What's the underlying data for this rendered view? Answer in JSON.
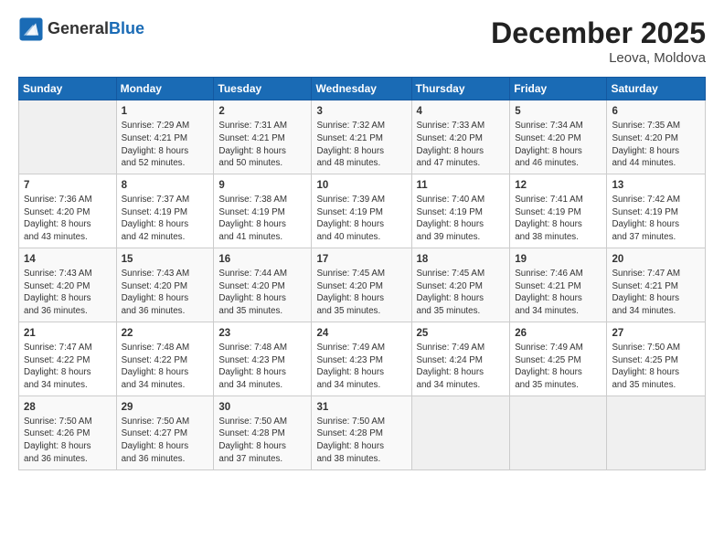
{
  "header": {
    "logo_line1": "General",
    "logo_line2": "Blue",
    "month": "December 2025",
    "location": "Leova, Moldova"
  },
  "weekdays": [
    "Sunday",
    "Monday",
    "Tuesday",
    "Wednesday",
    "Thursday",
    "Friday",
    "Saturday"
  ],
  "weeks": [
    [
      {
        "day": "",
        "info": ""
      },
      {
        "day": "1",
        "info": "Sunrise: 7:29 AM\nSunset: 4:21 PM\nDaylight: 8 hours\nand 52 minutes."
      },
      {
        "day": "2",
        "info": "Sunrise: 7:31 AM\nSunset: 4:21 PM\nDaylight: 8 hours\nand 50 minutes."
      },
      {
        "day": "3",
        "info": "Sunrise: 7:32 AM\nSunset: 4:21 PM\nDaylight: 8 hours\nand 48 minutes."
      },
      {
        "day": "4",
        "info": "Sunrise: 7:33 AM\nSunset: 4:20 PM\nDaylight: 8 hours\nand 47 minutes."
      },
      {
        "day": "5",
        "info": "Sunrise: 7:34 AM\nSunset: 4:20 PM\nDaylight: 8 hours\nand 46 minutes."
      },
      {
        "day": "6",
        "info": "Sunrise: 7:35 AM\nSunset: 4:20 PM\nDaylight: 8 hours\nand 44 minutes."
      }
    ],
    [
      {
        "day": "7",
        "info": "Sunrise: 7:36 AM\nSunset: 4:20 PM\nDaylight: 8 hours\nand 43 minutes."
      },
      {
        "day": "8",
        "info": "Sunrise: 7:37 AM\nSunset: 4:19 PM\nDaylight: 8 hours\nand 42 minutes."
      },
      {
        "day": "9",
        "info": "Sunrise: 7:38 AM\nSunset: 4:19 PM\nDaylight: 8 hours\nand 41 minutes."
      },
      {
        "day": "10",
        "info": "Sunrise: 7:39 AM\nSunset: 4:19 PM\nDaylight: 8 hours\nand 40 minutes."
      },
      {
        "day": "11",
        "info": "Sunrise: 7:40 AM\nSunset: 4:19 PM\nDaylight: 8 hours\nand 39 minutes."
      },
      {
        "day": "12",
        "info": "Sunrise: 7:41 AM\nSunset: 4:19 PM\nDaylight: 8 hours\nand 38 minutes."
      },
      {
        "day": "13",
        "info": "Sunrise: 7:42 AM\nSunset: 4:19 PM\nDaylight: 8 hours\nand 37 minutes."
      }
    ],
    [
      {
        "day": "14",
        "info": "Sunrise: 7:43 AM\nSunset: 4:20 PM\nDaylight: 8 hours\nand 36 minutes."
      },
      {
        "day": "15",
        "info": "Sunrise: 7:43 AM\nSunset: 4:20 PM\nDaylight: 8 hours\nand 36 minutes."
      },
      {
        "day": "16",
        "info": "Sunrise: 7:44 AM\nSunset: 4:20 PM\nDaylight: 8 hours\nand 35 minutes."
      },
      {
        "day": "17",
        "info": "Sunrise: 7:45 AM\nSunset: 4:20 PM\nDaylight: 8 hours\nand 35 minutes."
      },
      {
        "day": "18",
        "info": "Sunrise: 7:45 AM\nSunset: 4:20 PM\nDaylight: 8 hours\nand 35 minutes."
      },
      {
        "day": "19",
        "info": "Sunrise: 7:46 AM\nSunset: 4:21 PM\nDaylight: 8 hours\nand 34 minutes."
      },
      {
        "day": "20",
        "info": "Sunrise: 7:47 AM\nSunset: 4:21 PM\nDaylight: 8 hours\nand 34 minutes."
      }
    ],
    [
      {
        "day": "21",
        "info": "Sunrise: 7:47 AM\nSunset: 4:22 PM\nDaylight: 8 hours\nand 34 minutes."
      },
      {
        "day": "22",
        "info": "Sunrise: 7:48 AM\nSunset: 4:22 PM\nDaylight: 8 hours\nand 34 minutes."
      },
      {
        "day": "23",
        "info": "Sunrise: 7:48 AM\nSunset: 4:23 PM\nDaylight: 8 hours\nand 34 minutes."
      },
      {
        "day": "24",
        "info": "Sunrise: 7:49 AM\nSunset: 4:23 PM\nDaylight: 8 hours\nand 34 minutes."
      },
      {
        "day": "25",
        "info": "Sunrise: 7:49 AM\nSunset: 4:24 PM\nDaylight: 8 hours\nand 34 minutes."
      },
      {
        "day": "26",
        "info": "Sunrise: 7:49 AM\nSunset: 4:25 PM\nDaylight: 8 hours\nand 35 minutes."
      },
      {
        "day": "27",
        "info": "Sunrise: 7:50 AM\nSunset: 4:25 PM\nDaylight: 8 hours\nand 35 minutes."
      }
    ],
    [
      {
        "day": "28",
        "info": "Sunrise: 7:50 AM\nSunset: 4:26 PM\nDaylight: 8 hours\nand 36 minutes."
      },
      {
        "day": "29",
        "info": "Sunrise: 7:50 AM\nSunset: 4:27 PM\nDaylight: 8 hours\nand 36 minutes."
      },
      {
        "day": "30",
        "info": "Sunrise: 7:50 AM\nSunset: 4:28 PM\nDaylight: 8 hours\nand 37 minutes."
      },
      {
        "day": "31",
        "info": "Sunrise: 7:50 AM\nSunset: 4:28 PM\nDaylight: 8 hours\nand 38 minutes."
      },
      {
        "day": "",
        "info": ""
      },
      {
        "day": "",
        "info": ""
      },
      {
        "day": "",
        "info": ""
      }
    ]
  ]
}
